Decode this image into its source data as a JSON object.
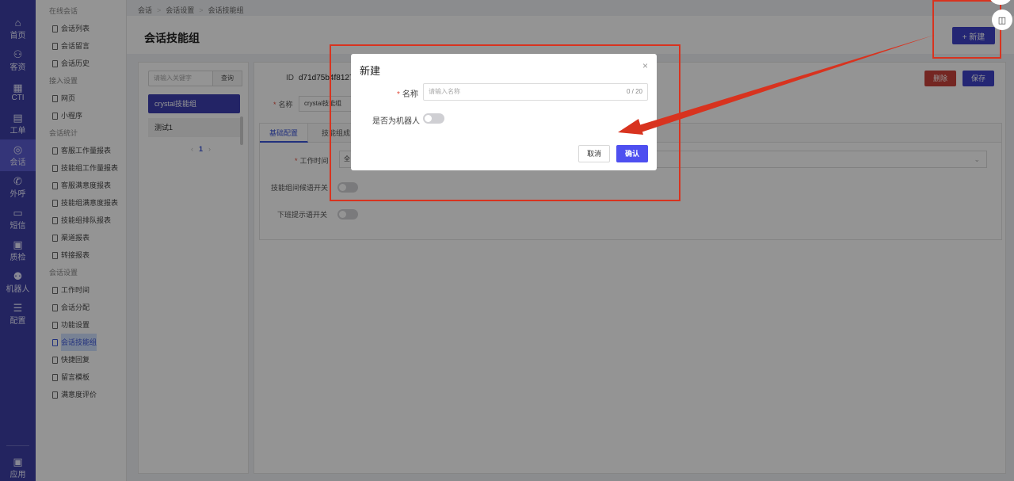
{
  "rail": {
    "items": [
      {
        "label": "首页",
        "icon": "home-icon",
        "glyph": "⌂"
      },
      {
        "label": "客资",
        "icon": "users-icon",
        "glyph": "⚇"
      },
      {
        "label": "CTI",
        "icon": "cti-icon",
        "glyph": "▦"
      },
      {
        "label": "工单",
        "icon": "ticket-icon",
        "glyph": "▤"
      },
      {
        "label": "会话",
        "icon": "chat-icon",
        "glyph": "◎"
      },
      {
        "label": "外呼",
        "icon": "phone-icon",
        "glyph": "✆"
      },
      {
        "label": "短信",
        "icon": "sms-icon",
        "glyph": "▭"
      },
      {
        "label": "质检",
        "icon": "inspect-icon",
        "glyph": "▣"
      },
      {
        "label": "机器人",
        "icon": "robot-icon",
        "glyph": "⚉"
      },
      {
        "label": "配置",
        "icon": "settings-icon",
        "glyph": "☰"
      }
    ],
    "bottom": {
      "label": "应用",
      "icon": "apps-icon",
      "glyph": "▣"
    }
  },
  "menu": {
    "groups": [
      {
        "title": "在线会话",
        "items": [
          "会话列表",
          "会话留言",
          "会话历史"
        ]
      },
      {
        "title": "接入设置",
        "items": [
          "网页",
          "小程序"
        ]
      },
      {
        "title": "会话统计",
        "items": [
          "客服工作量报表",
          "技能组工作量报表",
          "客服满意度报表",
          "技能组满意度报表",
          "技能组排队报表",
          "渠道报表",
          "转接报表"
        ]
      },
      {
        "title": "会话设置",
        "items": [
          "工作时间",
          "会话分配",
          "功能设置",
          "会话技能组",
          "快捷回复",
          "留言模板",
          "满意度评价"
        ]
      }
    ],
    "active": "会话技能组"
  },
  "breadcrumb": [
    "会话",
    "会话设置",
    "会话技能组"
  ],
  "page": {
    "title": "会话技能组",
    "new_button": "+ 新建"
  },
  "list": {
    "search_placeholder": "请输入关键字",
    "search_button": "查询",
    "items": [
      "crystal技能组",
      "测试1"
    ],
    "pager": {
      "prev": "‹",
      "current": "1",
      "next": "›"
    }
  },
  "detail": {
    "id_label": "ID",
    "id_value": "d71d75b4f8127",
    "delete": "删除",
    "save": "保存",
    "name_label": "名称",
    "name_value": "crystal技能组",
    "tabs": [
      "基础配置",
      "技能组成"
    ],
    "work_time_label": "工作时间",
    "work_time_value": "全",
    "transfer_switch_label": "技能组间候语开关",
    "offwork_switch_label": "下班提示语开关"
  },
  "modal": {
    "title": "新建",
    "close": "×",
    "name_label": "名称",
    "name_placeholder": "请输入名称",
    "name_count": "0 / 20",
    "robot_label": "是否为机器人",
    "cancel": "取消",
    "confirm": "确认"
  },
  "colors": {
    "rail": "#3d3fa6",
    "primary": "#3f43c9",
    "danger": "#c9433b",
    "annotation": "#d8331f"
  }
}
